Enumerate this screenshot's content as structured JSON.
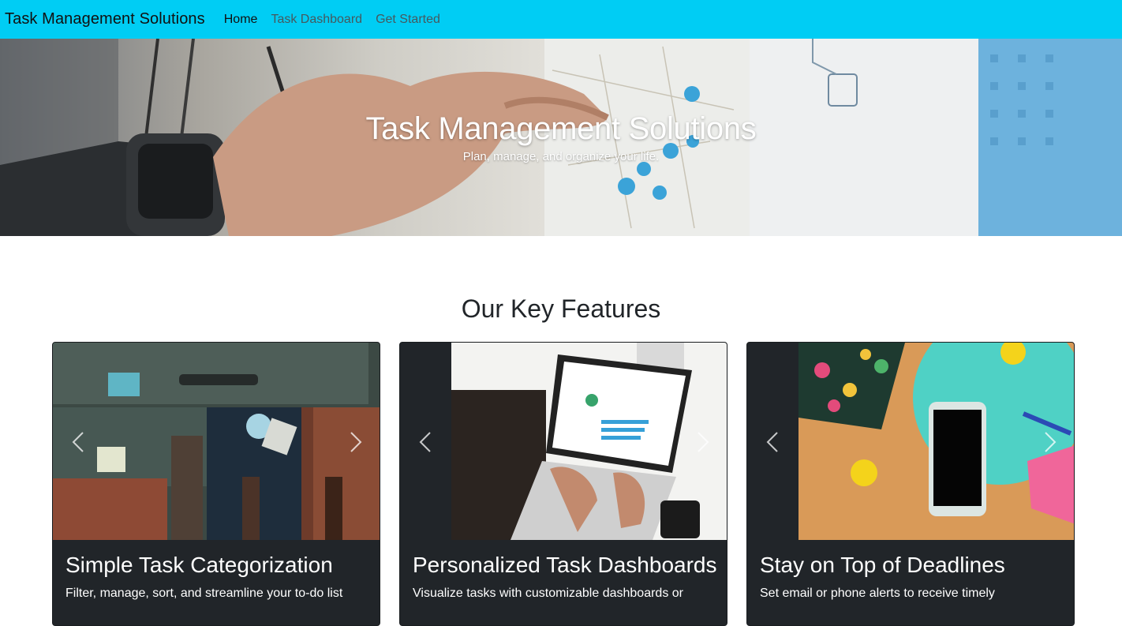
{
  "navbar": {
    "brand": "Task Management Solutions",
    "links": [
      {
        "label": "Home",
        "active": true
      },
      {
        "label": "Task Dashboard",
        "active": false
      },
      {
        "label": "Get Started",
        "active": false
      }
    ],
    "background": "#00cdf4"
  },
  "hero": {
    "title": "Task Management Solutions",
    "subtitle": "Plan, manage, and organize your life."
  },
  "features": {
    "heading": "Our Key Features",
    "cards": [
      {
        "title": "Simple Task Categorization",
        "text": "Filter, manage, sort, and streamline your to-do list",
        "image": "suitcases-photo"
      },
      {
        "title": "Personalized Task Dashboards",
        "text": "Visualize tasks with customizable dashboards or",
        "image": "laptop-dashboard-photo"
      },
      {
        "title": "Stay on Top of Deadlines",
        "text": "Set email or phone alerts to receive timely",
        "image": "phone-desk-photo"
      }
    ],
    "card_background": "#212529"
  },
  "icons": {
    "prev": "chevron-left-icon",
    "next": "chevron-right-icon"
  }
}
